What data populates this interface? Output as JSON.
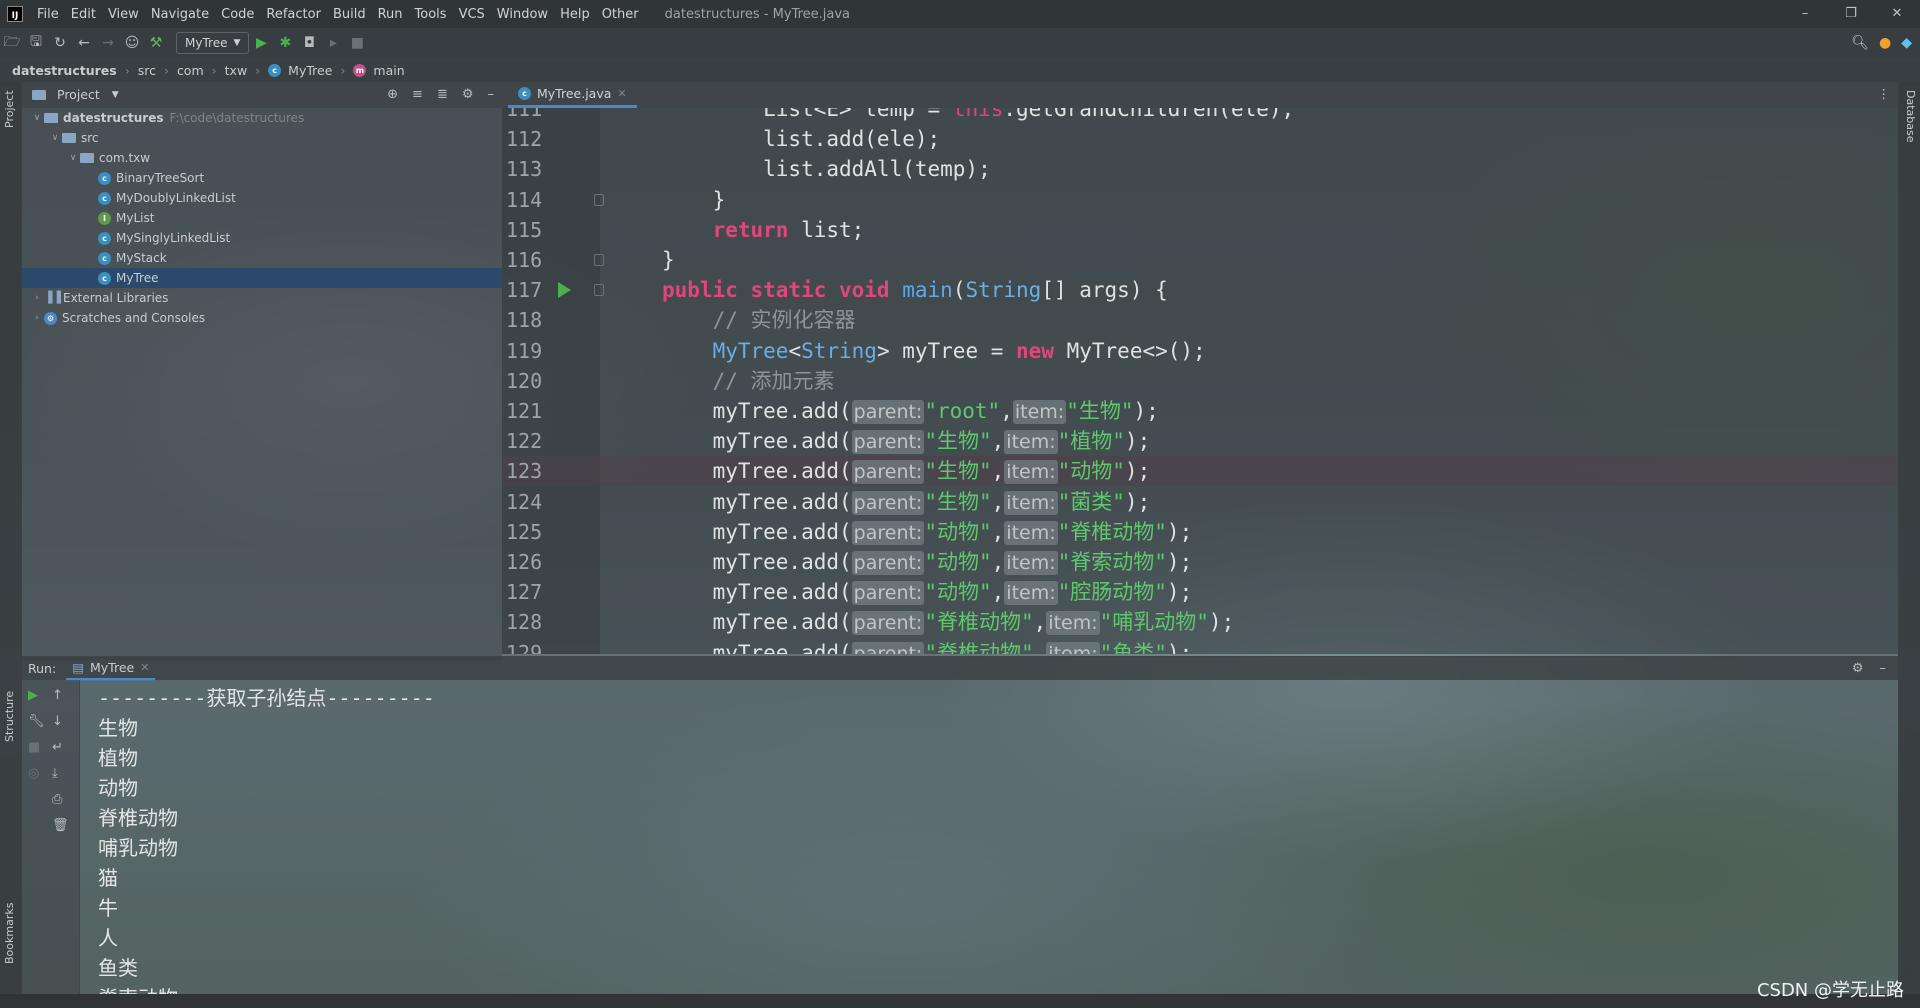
{
  "menubar": {
    "logo": "IJ",
    "items": [
      "File",
      "Edit",
      "View",
      "Navigate",
      "Code",
      "Refactor",
      "Build",
      "Run",
      "Tools",
      "VCS",
      "Window",
      "Help",
      "Other"
    ],
    "title": "datestructures - MyTree.java"
  },
  "toolbar": {
    "run_config": "MyTree"
  },
  "breadcrumb": [
    "datestructures",
    "src",
    "com",
    "txw",
    "MyTree",
    "main"
  ],
  "left_strip": {
    "project": "Project",
    "structure": "Structure",
    "bookmarks": "Bookmarks"
  },
  "right_strip": {
    "database": "Database"
  },
  "project": {
    "header": "Project",
    "tree": [
      {
        "label": "datestructures",
        "hint": "F:\\code\\datestructures",
        "level": 0,
        "kind": "folder",
        "expanded": true,
        "bold": true
      },
      {
        "label": "src",
        "level": 1,
        "kind": "folder",
        "expanded": true
      },
      {
        "label": "com.txw",
        "level": 2,
        "kind": "folder",
        "expanded": true
      },
      {
        "label": "BinaryTreeSort",
        "level": 3,
        "kind": "class"
      },
      {
        "label": "MyDoublyLinkedList",
        "level": 3,
        "kind": "class"
      },
      {
        "label": "MyList",
        "level": 3,
        "kind": "interface"
      },
      {
        "label": "MySinglyLinkedList",
        "level": 3,
        "kind": "class"
      },
      {
        "label": "MyStack",
        "level": 3,
        "kind": "class"
      },
      {
        "label": "MyTree",
        "level": 3,
        "kind": "class",
        "selected": true
      },
      {
        "label": "External Libraries",
        "level": 0,
        "kind": "lib",
        "expanded": false
      },
      {
        "label": "Scratches and Consoles",
        "level": 0,
        "kind": "scratch",
        "expanded": false
      }
    ]
  },
  "editor": {
    "tab": "MyTree.java",
    "current_line": 123,
    "lines": [
      {
        "n": "111",
        "html": "        List&lt;E&gt; temp = <span class='kw2'>this</span>.getGrandChildren(ele);"
      },
      {
        "n": "112",
        "html": "        list.add(ele);"
      },
      {
        "n": "113",
        "html": "        list.addAll(temp);"
      },
      {
        "n": "114",
        "html": "    }"
      },
      {
        "n": "115",
        "html": "    <span class='kw'>return</span> list;"
      },
      {
        "n": "116",
        "html": "}"
      },
      {
        "n": "117",
        "html": "<span class='kw'>public static void</span> <span class='fn'>main</span>(<span class='type'>String</span>[] args) {"
      },
      {
        "n": "118",
        "html": "    <span class='cmt'>// 实例化容器</span>"
      },
      {
        "n": "119",
        "html": "    <span class='type'>MyTree</span>&lt;<span class='type'>String</span>&gt; myTree = <span class='kw'>new</span> MyTree&lt;&gt;();"
      },
      {
        "n": "120",
        "html": "    <span class='cmt'>// 添加元素</span>"
      },
      {
        "n": "121",
        "html": "    myTree.add(<span class='hint'>parent:</span><span class='str'>\"root\"</span>,<span class='hint'>item:</span><span class='str'>\"生物\"</span>);"
      },
      {
        "n": "122",
        "html": "    myTree.add(<span class='hint'>parent:</span><span class='str'>\"生物\"</span>,<span class='hint'>item:</span><span class='str'>\"植物\"</span>);"
      },
      {
        "n": "123",
        "html": "    myTree.add(<span class='hint'>parent:</span><span class='str'>\"生物\"</span>,<span class='hint'>item:</span><span class='str'>\"动物\"</span>);"
      },
      {
        "n": "124",
        "html": "    myTree.add(<span class='hint'>parent:</span><span class='str'>\"生物\"</span>,<span class='hint'>item:</span><span class='str'>\"菌类\"</span>);"
      },
      {
        "n": "125",
        "html": "    myTree.add(<span class='hint'>parent:</span><span class='str'>\"动物\"</span>,<span class='hint'>item:</span><span class='str'>\"脊椎动物\"</span>);"
      },
      {
        "n": "126",
        "html": "    myTree.add(<span class='hint'>parent:</span><span class='str'>\"动物\"</span>,<span class='hint'>item:</span><span class='str'>\"脊索动物\"</span>);"
      },
      {
        "n": "127",
        "html": "    myTree.add(<span class='hint'>parent:</span><span class='str'>\"动物\"</span>,<span class='hint'>item:</span><span class='str'>\"腔肠动物\"</span>);"
      },
      {
        "n": "128",
        "html": "    myTree.add(<span class='hint'>parent:</span><span class='str'>\"脊椎动物\"</span>,<span class='hint'>item:</span><span class='str'>\"哺乳动物\"</span>);"
      },
      {
        "n": "129",
        "html": "    myTree.add(<span class='hint'>parent:</span><span class='str'>\"脊椎动物\"</span>,<span class='hint'>item:</span><span class='str'>\"鱼类\"</span>);"
      }
    ]
  },
  "run": {
    "label": "Run:",
    "tab": "MyTree",
    "output": [
      "---------获取子孙结点---------",
      "生物",
      "植物",
      "动物",
      "脊椎动物",
      "哺乳动物",
      "猫",
      "牛",
      "人",
      "鱼类",
      "脊索动物"
    ]
  },
  "watermark": "CSDN @学无止路"
}
